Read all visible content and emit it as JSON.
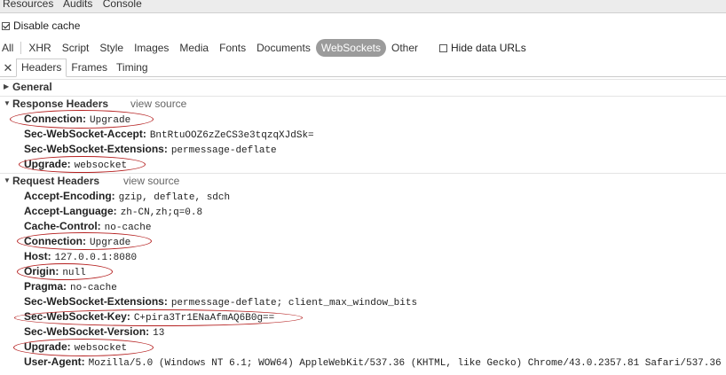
{
  "topbar": {
    "items": [
      "Resources",
      "Audits",
      "Console"
    ]
  },
  "disable_cache": {
    "label": "Disable cache",
    "checked": true
  },
  "filters": {
    "items": [
      "All",
      "XHR",
      "Script",
      "Style",
      "Images",
      "Media",
      "Fonts",
      "Documents",
      "WebSockets",
      "Other"
    ],
    "active": "WebSockets",
    "hide_data_urls": "Hide data URLs"
  },
  "tabs": {
    "close": "✕",
    "items": [
      "Headers",
      "Frames",
      "Timing"
    ],
    "active": "Headers"
  },
  "general": {
    "title": "General",
    "collapsed": true
  },
  "response_headers": {
    "title": "Response Headers",
    "view_source": "view source",
    "rows": [
      {
        "name": "Connection:",
        "value": "Upgrade"
      },
      {
        "name": "Sec-WebSocket-Accept:",
        "value": "BntRtuOOZ6zZeCS3e3tqzqXJdSk="
      },
      {
        "name": "Sec-WebSocket-Extensions:",
        "value": "permessage-deflate"
      },
      {
        "name": "Upgrade:",
        "value": "websocket"
      }
    ]
  },
  "request_headers": {
    "title": "Request Headers",
    "view_source": "view source",
    "rows": [
      {
        "name": "Accept-Encoding:",
        "value": "gzip, deflate, sdch"
      },
      {
        "name": "Accept-Language:",
        "value": "zh-CN,zh;q=0.8"
      },
      {
        "name": "Cache-Control:",
        "value": "no-cache"
      },
      {
        "name": "Connection:",
        "value": "Upgrade"
      },
      {
        "name": "Host:",
        "value": "127.0.0.1:8080"
      },
      {
        "name": "Origin:",
        "value": "null"
      },
      {
        "name": "Pragma:",
        "value": "no-cache"
      },
      {
        "name": "Sec-WebSocket-Extensions:",
        "value": "permessage-deflate; client_max_window_bits"
      },
      {
        "name": "Sec-WebSocket-Key:",
        "value": "C+pira3Tr1ENaAfmAQ6B0g=="
      },
      {
        "name": "Sec-WebSocket-Version:",
        "value": "13"
      },
      {
        "name": "Upgrade:",
        "value": "websocket"
      },
      {
        "name": "User-Agent:",
        "value": "Mozilla/5.0 (Windows NT 6.1; WOW64) AppleWebKit/537.36 (KHTML, like Gecko) Chrome/43.0.2357.81 Safari/537.36"
      }
    ]
  },
  "annotation_color": "#b52020"
}
